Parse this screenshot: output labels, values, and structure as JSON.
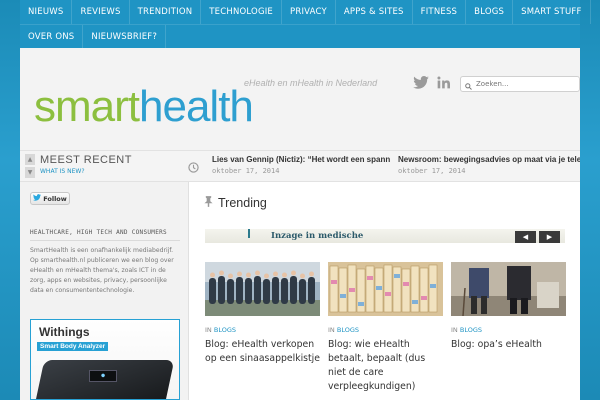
{
  "nav": {
    "row1": [
      "NIEUWS",
      "REVIEWS",
      "TRENDITION",
      "TECHNOLOGIE",
      "PRIVACY",
      "APPS & SITES",
      "FITNESS",
      "BLOGS",
      "SMART STUFF"
    ],
    "row2": [
      "OVER ONS",
      "NIEUWSBRIEF?"
    ]
  },
  "header": {
    "logo_part1": "smart",
    "logo_part2": "health",
    "tagline": "eHealth en mHealth in Nederland",
    "search_placeholder": "Zoeken..."
  },
  "recent": {
    "title": "MEEST RECENT",
    "subtitle": "WHAT IS NEW?",
    "items": [
      {
        "headline": "Lies van Gennip (Nictiz): “Het wordt een spann",
        "date": "oktober 17, 2014"
      },
      {
        "headline": "Newsroom: bewegingsadvies op maat via je tele",
        "date": "oktober 17, 2014"
      }
    ]
  },
  "sidebar": {
    "follow_label": "Follow",
    "heading": "HEALTHCARE, HIGH TECH AND CONSUMERS",
    "text": "SmartHealth is een onafhankelijk mediabedrijf. Op smarthealth.nl publiceren we een blog over eHealth en mHealth thema's, zoals ICT in de zorg, apps en websites, privacy, persoonlijke data en consumententechnologie.",
    "ad_brand": "Withings",
    "ad_product": "Smart Body Analyzer"
  },
  "main": {
    "section_title": "Trending",
    "slider_text": "Inzage in medische",
    "cards": [
      {
        "in": "IN",
        "category": "BLOGS",
        "title": "Blog: eHealth verkopen op een sinaasappelkistje"
      },
      {
        "in": "IN",
        "category": "BLOGS",
        "title": "Blog: wie eHealth betaalt, bepaalt (dus niet de care verpleegkundigen)"
      },
      {
        "in": "IN",
        "category": "BLOGS",
        "title": "Blog: opa’s eHealth"
      }
    ]
  },
  "colors": {
    "nav_bg": "#1f94c4",
    "logo_green": "#8cbf3f",
    "logo_blue": "#2e9fd0",
    "link_blue": "#1f94c4"
  },
  "icons": [
    "twitter-icon",
    "linkedin-icon",
    "search-icon",
    "clock-icon",
    "pin-icon",
    "twitter-bird-icon"
  ]
}
